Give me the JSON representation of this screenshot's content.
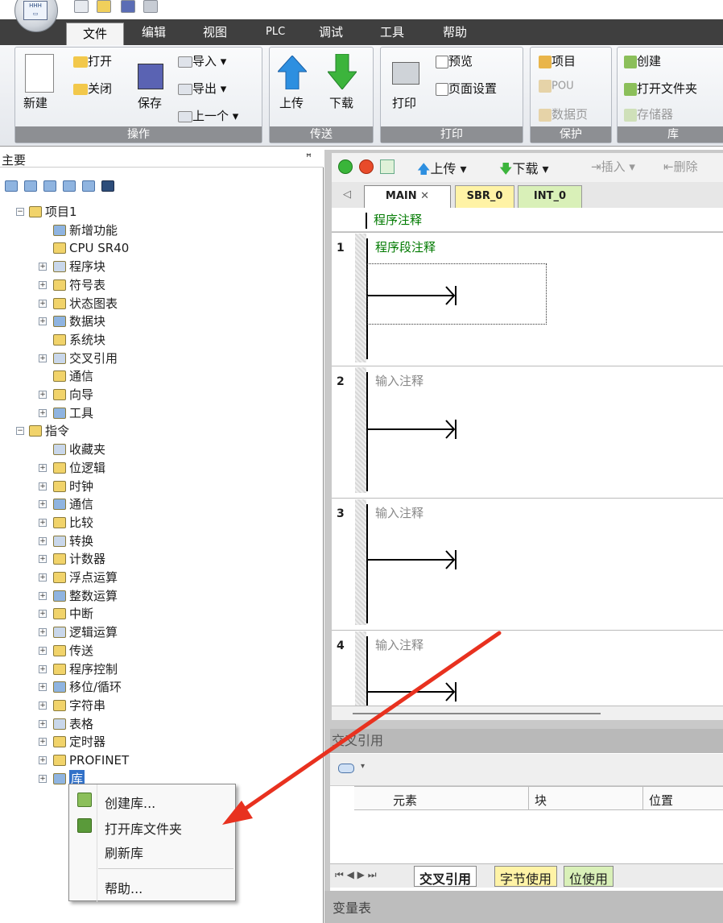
{
  "menu": {
    "items": [
      "文件",
      "编辑",
      "视图",
      "PLC",
      "调试",
      "工具",
      "帮助"
    ],
    "active": "文件"
  },
  "ribbon": {
    "groups": [
      {
        "caption": "操作",
        "buttons": {
          "new": "新建",
          "open": "打开",
          "close": "关闭",
          "save": "保存",
          "import": "导入",
          "export": "导出",
          "previous": "上一个"
        }
      },
      {
        "caption": "传送",
        "buttons": {
          "upload": "上传",
          "download": "下载"
        }
      },
      {
        "caption": "打印",
        "buttons": {
          "print": "打印",
          "preview": "预览",
          "page_setup": "页面设置"
        }
      },
      {
        "caption": "保护",
        "buttons": {
          "project": "项目",
          "pou": "POU",
          "data_page": "数据页"
        }
      },
      {
        "caption": "库",
        "buttons": {
          "create": "创建",
          "open_folder": "打开文件夹",
          "memory": "存储器"
        }
      }
    ]
  },
  "left_pane": {
    "title": "主要",
    "tree": [
      {
        "label": "项目1",
        "level": 0,
        "expander": "minus"
      },
      {
        "label": "新增功能",
        "level": 1,
        "expander": "none"
      },
      {
        "label": "CPU SR40",
        "level": 1,
        "expander": "none"
      },
      {
        "label": "程序块",
        "level": 1,
        "expander": "plus"
      },
      {
        "label": "符号表",
        "level": 1,
        "expander": "plus"
      },
      {
        "label": "状态图表",
        "level": 1,
        "expander": "plus"
      },
      {
        "label": "数据块",
        "level": 1,
        "expander": "plus"
      },
      {
        "label": "系统块",
        "level": 1,
        "expander": "none"
      },
      {
        "label": "交叉引用",
        "level": 1,
        "expander": "plus"
      },
      {
        "label": "通信",
        "level": 1,
        "expander": "none"
      },
      {
        "label": "向导",
        "level": 1,
        "expander": "plus"
      },
      {
        "label": "工具",
        "level": 1,
        "expander": "plus"
      },
      {
        "label": "指令",
        "level": 0,
        "expander": "minus"
      },
      {
        "label": "收藏夹",
        "level": 1,
        "expander": "none"
      },
      {
        "label": "位逻辑",
        "level": 1,
        "expander": "plus"
      },
      {
        "label": "时钟",
        "level": 1,
        "expander": "plus"
      },
      {
        "label": "通信",
        "level": 1,
        "expander": "plus"
      },
      {
        "label": "比较",
        "level": 1,
        "expander": "plus"
      },
      {
        "label": "转换",
        "level": 1,
        "expander": "plus"
      },
      {
        "label": "计数器",
        "level": 1,
        "expander": "plus"
      },
      {
        "label": "浮点运算",
        "level": 1,
        "expander": "plus"
      },
      {
        "label": "整数运算",
        "level": 1,
        "expander": "plus"
      },
      {
        "label": "中断",
        "level": 1,
        "expander": "plus"
      },
      {
        "label": "逻辑运算",
        "level": 1,
        "expander": "plus"
      },
      {
        "label": "传送",
        "level": 1,
        "expander": "plus"
      },
      {
        "label": "程序控制",
        "level": 1,
        "expander": "plus"
      },
      {
        "label": "移位/循环",
        "level": 1,
        "expander": "plus"
      },
      {
        "label": "字符串",
        "level": 1,
        "expander": "plus"
      },
      {
        "label": "表格",
        "level": 1,
        "expander": "plus"
      },
      {
        "label": "定时器",
        "level": 1,
        "expander": "plus"
      },
      {
        "label": "PROFINET",
        "level": 1,
        "expander": "plus"
      },
      {
        "label": "库",
        "level": 1,
        "expander": "plus",
        "selected": true
      }
    ]
  },
  "editor": {
    "toolbar": {
      "upload": "上传",
      "download": "下载",
      "insert": "插入",
      "delete": "删除"
    },
    "tabs": [
      "MAIN",
      "SBR_0",
      "INT_0"
    ],
    "active_tab": "MAIN",
    "program_comment": "程序注释",
    "networks": [
      {
        "number": "1",
        "comment": "程序段注释"
      },
      {
        "number": "2",
        "comment": "输入注释"
      },
      {
        "number": "3",
        "comment": "输入注释"
      },
      {
        "number": "4",
        "comment": "输入注释"
      }
    ]
  },
  "cross_ref": {
    "title": "交叉引用",
    "columns": [
      "元素",
      "块",
      "位置"
    ],
    "bottom_tabs": [
      "交叉引用",
      "字节使用",
      "位使用"
    ]
  },
  "var_table": {
    "title": "变量表"
  },
  "context_menu": {
    "items": [
      "创建库...",
      "打开库文件夹",
      "刷新库",
      "帮助..."
    ]
  },
  "colors": {
    "menubar": "#3f3f3f",
    "ribbon_caption": "#8d8f93",
    "comment_green": "#007a00",
    "arrow": "#e8311f"
  }
}
